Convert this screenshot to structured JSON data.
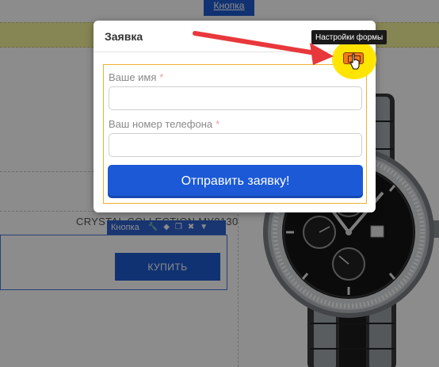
{
  "background": {
    "top_button_label": "Кнопка",
    "product_title": "CRYSTAL COLLECTION MY8130",
    "buy_button_label": "КУПИТЬ",
    "toolbar": {
      "title": "Кнопка",
      "icons": [
        "wrench-icon",
        "drop-icon",
        "copy-icon",
        "close-icon",
        "chevron-down-icon"
      ]
    }
  },
  "modal": {
    "title": "Заявка",
    "close_glyph": "×",
    "fields": [
      {
        "label": "Ваше имя",
        "required_mark": "*",
        "value": "",
        "placeholder": ""
      },
      {
        "label": "Ваш номер телефона",
        "required_mark": "*",
        "value": "",
        "placeholder": ""
      }
    ],
    "submit_label": "Отправить заявку!"
  },
  "annotation": {
    "tooltip": "Настройки формы",
    "arrow_color": "#e8383c",
    "highlight_color": "#ffe400"
  },
  "colors": {
    "accent": "#1b59d6",
    "form_frame": "#f0b030",
    "settings_button": "#f07a20"
  }
}
